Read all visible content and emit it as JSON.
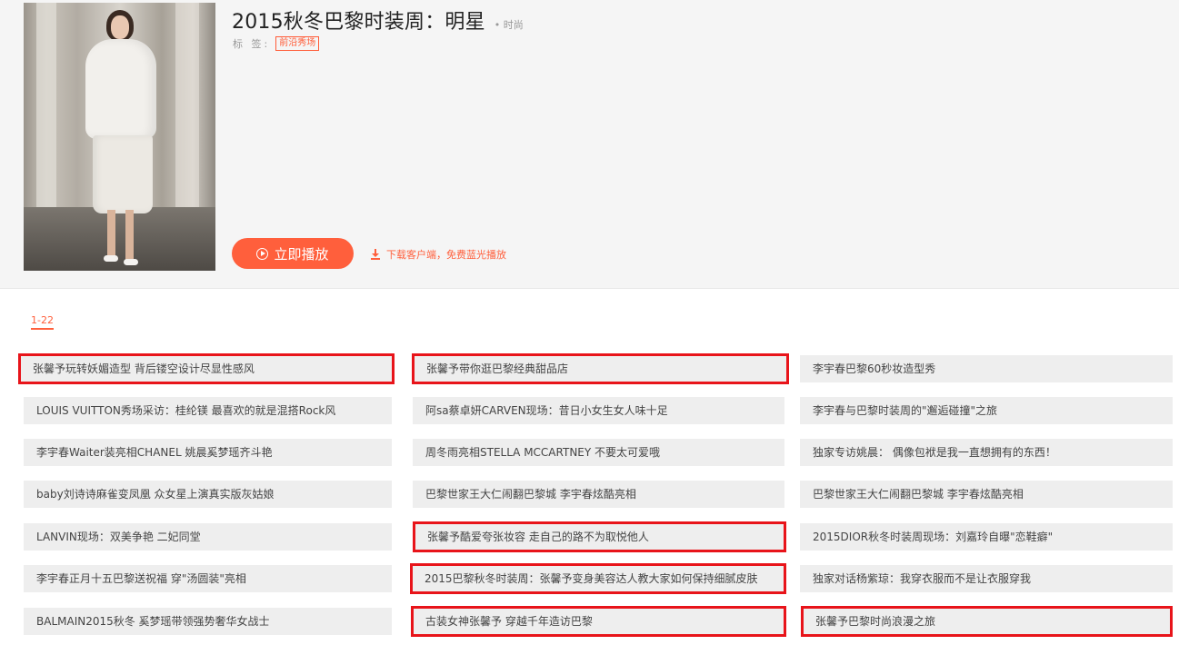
{
  "header": {
    "title": "2015秋冬巴黎时装周：明星",
    "category": "• 时尚",
    "tag_label": "标 签:",
    "tag": "前沿秀场"
  },
  "actions": {
    "play_label": "立即播放",
    "download_label": "下载客户端，免费蓝光播放"
  },
  "episodes_range": "1-22",
  "episodes": [
    "张馨予玩转妖媚造型 背后镂空设计尽显性感风",
    "张馨予带你逛巴黎经典甜品店",
    "李宇春巴黎60秒妆造型秀",
    "LOUIS VUITTON秀场采访：桂纶镁 最喜欢的就是混搭Rock风",
    "阿sa蔡卓妍CARVEN现场：昔日小女生女人味十足",
    "李宇春与巴黎时装周的\"邂逅碰撞\"之旅",
    "李宇春Waiter装亮相CHANEL 姚晨奚梦瑶齐斗艳",
    "周冬雨亮相STELLA MCCARTNEY 不要太可爱哦",
    "独家专访姚晨： 偶像包袱是我一直想拥有的东西！",
    "baby刘诗诗麻雀变凤凰 众女星上演真实版灰姑娘",
    "巴黎世家王大仁闹翻巴黎城 李宇春炫酷亮相",
    "巴黎世家王大仁闹翻巴黎城 李宇春炫酷亮相",
    "LANVIN现场：双美争艳 二妃同堂",
    "张馨予酷爱夸张妆容 走自己的路不为取悦他人",
    "2015DIOR秋冬时装周现场：刘嘉玲自曝\"恋鞋癖\"",
    "李宇春正月十五巴黎送祝福 穿\"汤圆装\"亮相",
    "2015巴黎秋冬时装周：张馨予变身美容达人教大家如何保持细腻皮肤",
    "独家对话杨紫琼：我穿衣服而不是让衣服穿我",
    "BALMAIN2015秋冬 奚梦瑶带领强势奢华女战士",
    "古装女神张馨予 穿越千年造访巴黎",
    "张馨予巴黎时尚浪漫之旅"
  ],
  "colors": {
    "accent": "#ff5f3c",
    "highlight": "#e8141a",
    "item_bg": "#eeeeee"
  }
}
